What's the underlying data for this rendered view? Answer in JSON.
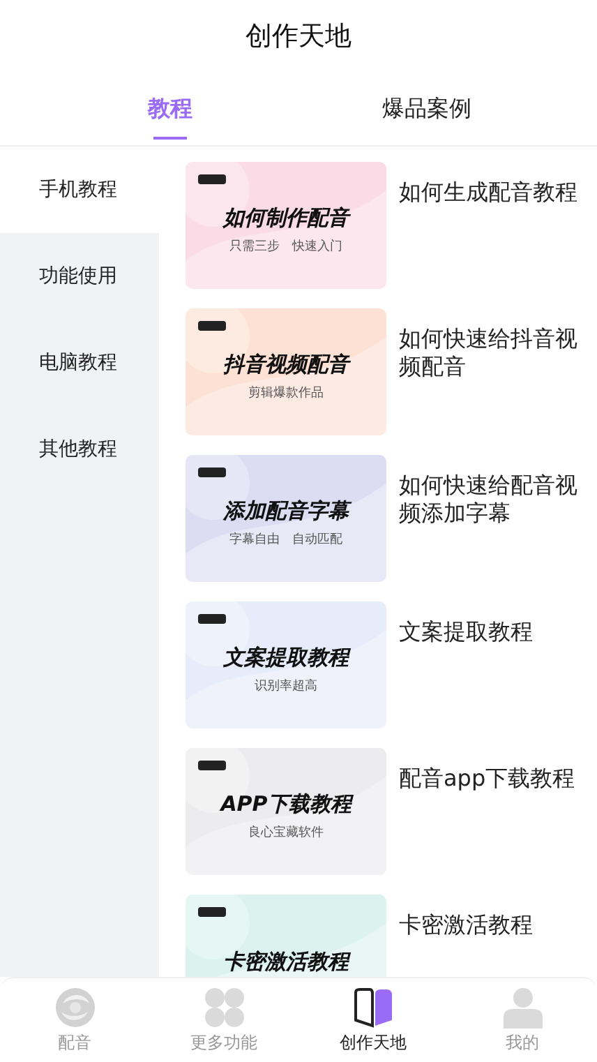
{
  "header": {
    "title": "创作天地"
  },
  "tabs": [
    {
      "label": "教程",
      "selected": true
    },
    {
      "label": "爆品案例",
      "selected": false
    }
  ],
  "sidebar": {
    "items": [
      {
        "label": "手机教程",
        "selected": true
      },
      {
        "label": "功能使用",
        "selected": false
      },
      {
        "label": "电脑教程",
        "selected": false
      },
      {
        "label": "其他教程",
        "selected": false
      }
    ]
  },
  "tutorials": [
    {
      "banner_title": "如何制作配音",
      "banner_subtitle": "只需三步　快速入门",
      "color": "#fadbe6",
      "title": "如何生成配音教程"
    },
    {
      "banner_title": "抖音视频配音",
      "banner_subtitle": "剪辑爆款作品",
      "color": "#fce1d4",
      "title": "如何快速给抖音视频配音"
    },
    {
      "banner_title": "添加配音字幕",
      "banner_subtitle": "字幕自由　自动匹配",
      "color": "#dcdcf3",
      "title": "如何快速给配音视频添加字幕"
    },
    {
      "banner_title": "文案提取教程",
      "banner_subtitle": "识别率超高",
      "color": "#e6ecf9",
      "title": "文案提取教程"
    },
    {
      "banner_title": "APP下载教程",
      "banner_subtitle": "良心宝藏软件",
      "color": "#ececee",
      "title": "配音app下载教程"
    },
    {
      "banner_title": "卡密激活教程",
      "color": "#dcf2ee",
      "title": "卡密激活教程"
    }
  ],
  "bottom_nav": [
    {
      "kind": "logo",
      "label": "配音",
      "selected": false
    },
    {
      "kind": "grid",
      "label": "更多功能",
      "selected": false
    },
    {
      "kind": "book",
      "label": "创作天地",
      "selected": true
    },
    {
      "kind": "person",
      "label": "我的",
      "selected": false
    }
  ]
}
